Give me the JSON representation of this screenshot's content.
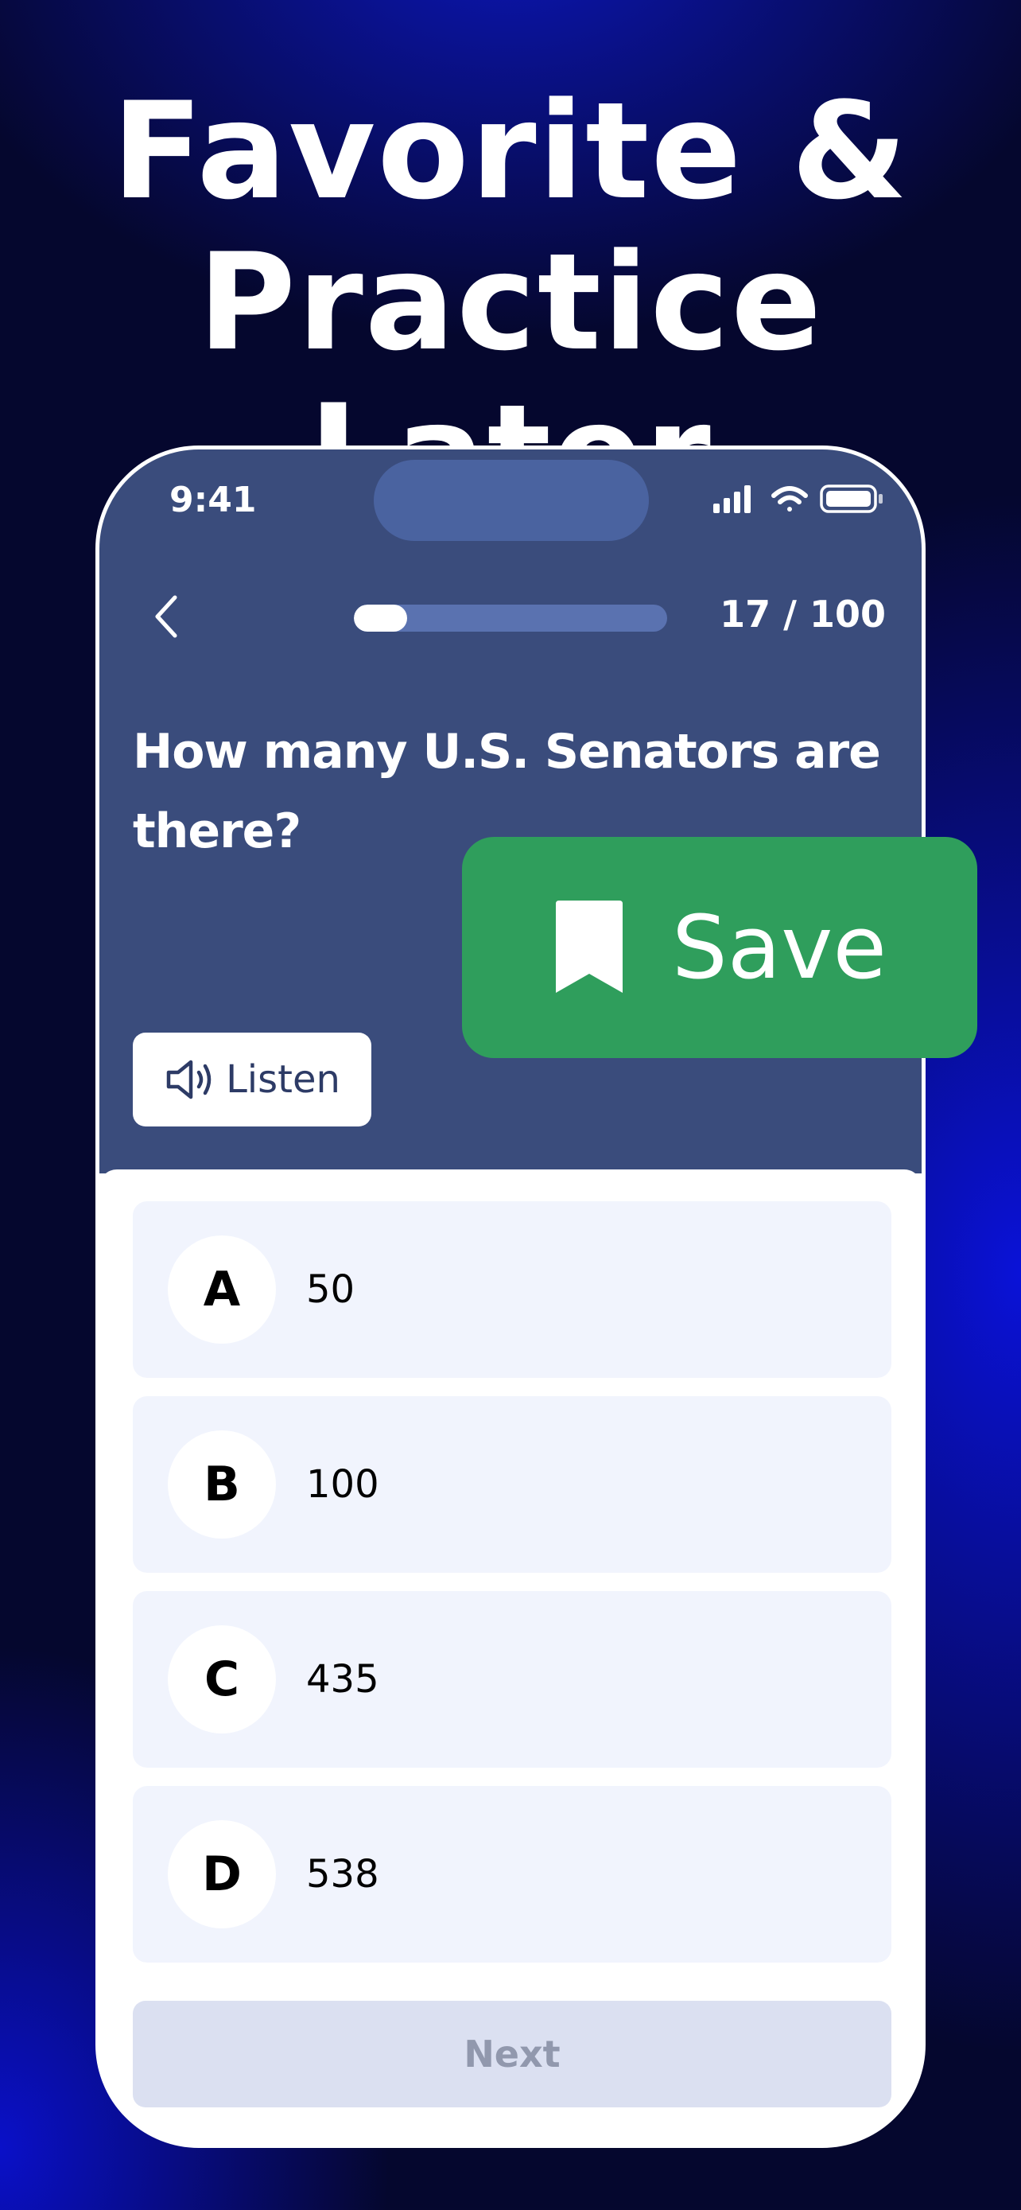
{
  "headline": {
    "line1": "Favorite &",
    "line2": "Practice Later"
  },
  "status_bar": {
    "time": "9:41"
  },
  "quiz": {
    "counter": "17 / 100",
    "progress_fraction": 0.17,
    "question": "How many U.S. Senators are there?",
    "listen_label": "Listen",
    "options": [
      {
        "letter": "A",
        "text": "50"
      },
      {
        "letter": "B",
        "text": "100"
      },
      {
        "letter": "C",
        "text": "435"
      },
      {
        "letter": "D",
        "text": "538"
      }
    ],
    "next_label": "Next"
  },
  "save_overlay": {
    "label": "Save"
  },
  "icons": {
    "back": "chevron-left-icon",
    "listen": "speaker-icon",
    "save": "bookmark-icon",
    "signal": "cellular-signal-icon",
    "wifi": "wifi-icon",
    "battery": "battery-icon"
  },
  "colors": {
    "accent_dark_blue": "#3a4c7c",
    "save_green": "#2f9e5c",
    "option_bg": "#f1f4fd",
    "next_disabled_bg": "#dbe0f1"
  }
}
